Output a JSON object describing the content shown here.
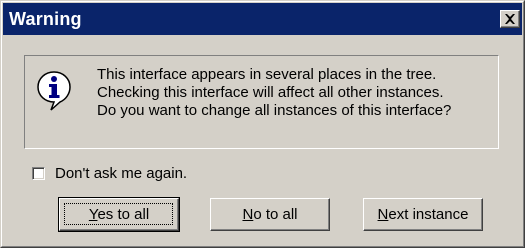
{
  "window": {
    "title": "Warning"
  },
  "icons": {
    "info": "information-icon",
    "close": "close-icon"
  },
  "message": {
    "lines": [
      "This interface appears in several places in the tree.",
      "Checking this interface will affect all other instances.",
      "Do you want to change all instances of this interface?"
    ]
  },
  "checkbox": {
    "label": "Don't ask me again.",
    "checked": false
  },
  "buttons": {
    "yes_to_all": {
      "mnemonic": "Y",
      "rest": "es to all"
    },
    "no_to_all": {
      "mnemonic": "N",
      "rest": "o to all"
    },
    "next_instance": {
      "mnemonic": "N",
      "rest": "ext instance"
    }
  },
  "colors": {
    "titlebar": "#0a246a",
    "face": "#d4d0c8",
    "info_circle": "#ffffff",
    "info_glyph": "#000080"
  }
}
